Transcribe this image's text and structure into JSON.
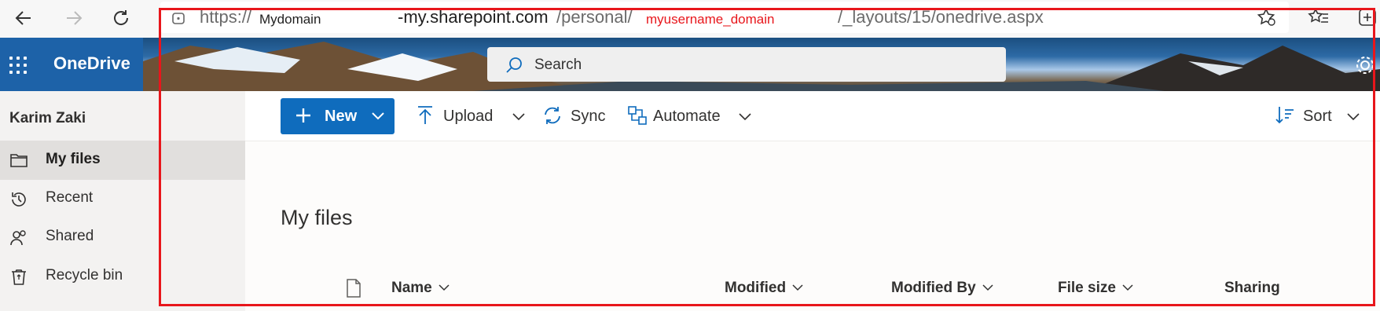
{
  "browser": {
    "url": {
      "scheme": "https://",
      "domain_overlay": "Mydomain",
      "host": "-my.sharepoint.com",
      "path1": "/personal/",
      "user_overlay": "myusername_domain",
      "path2": "/_layouts/15/onedrive.aspx"
    }
  },
  "app": {
    "name": "OneDrive",
    "search_placeholder": "Search"
  },
  "sidebar": {
    "user": "Karim Zaki",
    "items": [
      {
        "label": "My files",
        "icon": "folder-icon",
        "selected": true
      },
      {
        "label": "Recent",
        "icon": "history-icon",
        "selected": false
      },
      {
        "label": "Shared",
        "icon": "people-icon",
        "selected": false
      },
      {
        "label": "Recycle bin",
        "icon": "recycle-bin-icon",
        "selected": false
      }
    ]
  },
  "commandbar": {
    "new": "New",
    "upload": "Upload",
    "sync": "Sync",
    "automate": "Automate",
    "sort": "Sort"
  },
  "main": {
    "title": "My files",
    "columns": [
      "Name",
      "Modified",
      "Modified By",
      "File size",
      "Sharing"
    ]
  },
  "colors": {
    "brand": "#1d62a8",
    "primary_button": "#0f6cbd",
    "annotation": "#e8161b",
    "overlay_text": "#e8161b"
  }
}
